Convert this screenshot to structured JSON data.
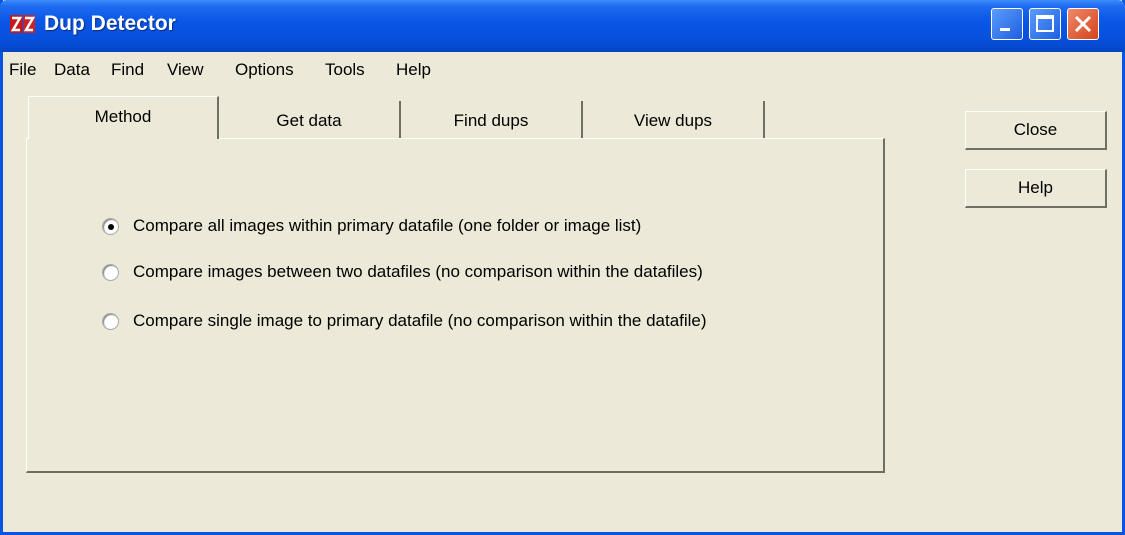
{
  "window": {
    "title": "Dup Detector",
    "colors": {
      "titlebar": "#0a56e6",
      "background": "#ece9d8",
      "close": "#d3431b"
    }
  },
  "menu": [
    "File",
    "Data",
    "Find",
    "View",
    "Options",
    "Tools",
    "Help"
  ],
  "tabs": [
    {
      "label": "Method",
      "active": true
    },
    {
      "label": "Get data",
      "active": false
    },
    {
      "label": "Find dups",
      "active": false
    },
    {
      "label": "View dups",
      "active": false
    }
  ],
  "method_options": [
    {
      "label": "Compare all images within primary datafile (one folder or image list)",
      "selected": true
    },
    {
      "label": "Compare images between two datafiles (no comparison within the datafiles)",
      "selected": false
    },
    {
      "label": "Compare single image to primary datafile (no comparison within the datafile)",
      "selected": false
    }
  ],
  "buttons": {
    "close": "Close",
    "help": "Help"
  }
}
